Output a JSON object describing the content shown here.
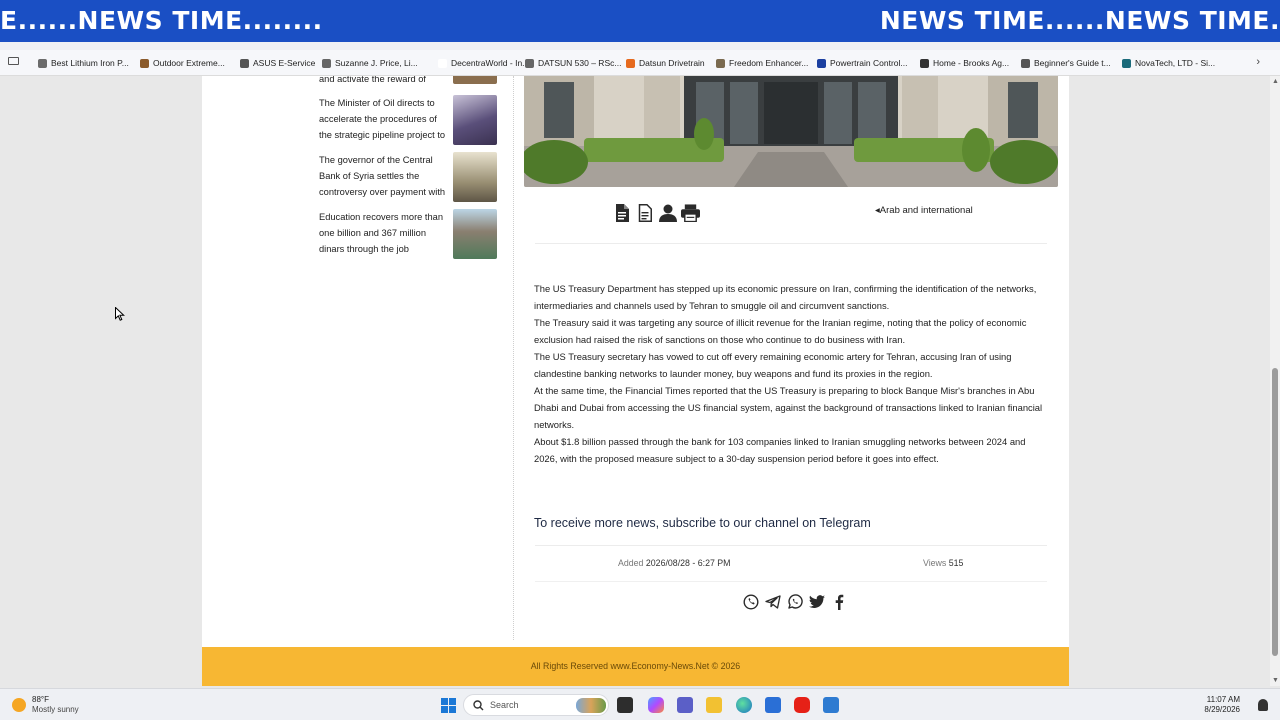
{
  "ticker": {
    "left_text": "E......NEWS TIME........",
    "right_text": "NEWS TIME......NEWS TIME."
  },
  "bookmarks": [
    {
      "label": "Best Lithium Iron P...",
      "icon": "bookmark-icon",
      "color": "#6b6b6b"
    },
    {
      "label": "Outdoor Extreme...",
      "icon": "bookmark-icon",
      "color": "#8a5a2b"
    },
    {
      "label": "ASUS E-Service",
      "icon": "folder-icon",
      "color": "#555555"
    },
    {
      "label": "Suzanne J. Price, Li...",
      "icon": "globe-icon",
      "color": "#666666"
    },
    {
      "label": "DecentraWorld - In...",
      "icon": "bookmark-icon",
      "color": "#ffffff"
    },
    {
      "label": "DATSUN 530 – RSc...",
      "icon": "globe-icon",
      "color": "#666666"
    },
    {
      "label": "Datsun Drivetrain",
      "icon": "bookmark-icon",
      "color": "#e66a1e"
    },
    {
      "label": "Freedom Enhancer...",
      "icon": "bookmark-icon",
      "color": "#7a6a4f"
    },
    {
      "label": "Powertrain Control...",
      "icon": "bookmark-icon",
      "color": "#1b3fa0"
    },
    {
      "label": "Home - Brooks Ag...",
      "icon": "bookmark-icon",
      "color": "#333333"
    },
    {
      "label": "Beginner's Guide t...",
      "icon": "bookmark-icon",
      "color": "#555555"
    },
    {
      "label": "NovaTech, LTD - Si...",
      "icon": "bookmark-icon",
      "color": "#1a6a7a"
    }
  ],
  "sidebar": {
    "items": [
      {
        "text": "and activate the reward of",
        "thumb_color": "#8a6e4e"
      },
      {
        "text": "The Minister of Oil directs to accelerate the procedures of the strategic pipeline project to",
        "thumb_color": "#5a4f7a"
      },
      {
        "text": "The governor of the Central Bank of Syria settles the controversy over payment with",
        "thumb_color": "#9a9074"
      },
      {
        "text": "Education recovers more than one billion and 367 million dinars through the job",
        "thumb_color": "#4f7a5a"
      }
    ]
  },
  "article": {
    "category": "Arab and international",
    "paragraphs": [
      "The US Treasury Department has stepped up its economic pressure on Iran, confirming the identification of the networks, intermediaries and channels used by Tehran to smuggle oil and circumvent sanctions.",
      "The Treasury said it was targeting any source of illicit revenue for the Iranian regime, noting that the policy of economic exclusion had raised the risk of sanctions on those who continue to do business with Iran.",
      "The US Treasury secretary has vowed to cut off every remaining economic artery for Tehran, accusing Iran of using clandestine banking networks to launder money, buy weapons and fund its proxies in the region.",
      "At the same time, the Financial Times reported that the US Treasury is preparing to block Banque Misr's branches in Abu Dhabi and Dubai from accessing the US financial system, against the background of transactions linked to Iranian financial networks.",
      "About $1.8 billion passed through the bank for 103 companies linked to Iranian smuggling networks between 2024 and 2026, with the proposed measure subject to a 30-day suspension period before it goes into effect."
    ],
    "telegram_cta": "To receive more news, subscribe to our channel on Telegram",
    "added_label": "Added",
    "added_value": "2026/08/28 - 6:27 PM",
    "views_label": "Views",
    "views_value": "515"
  },
  "footer": {
    "text": "All Rights Reserved www.Economy-News.Net © 2026",
    "color": "#f7b733"
  },
  "taskbar": {
    "temperature": "88°F",
    "condition": "Mostly sunny",
    "search_label": "Search",
    "time": "11:07 AM",
    "date": "8/29/2026"
  }
}
